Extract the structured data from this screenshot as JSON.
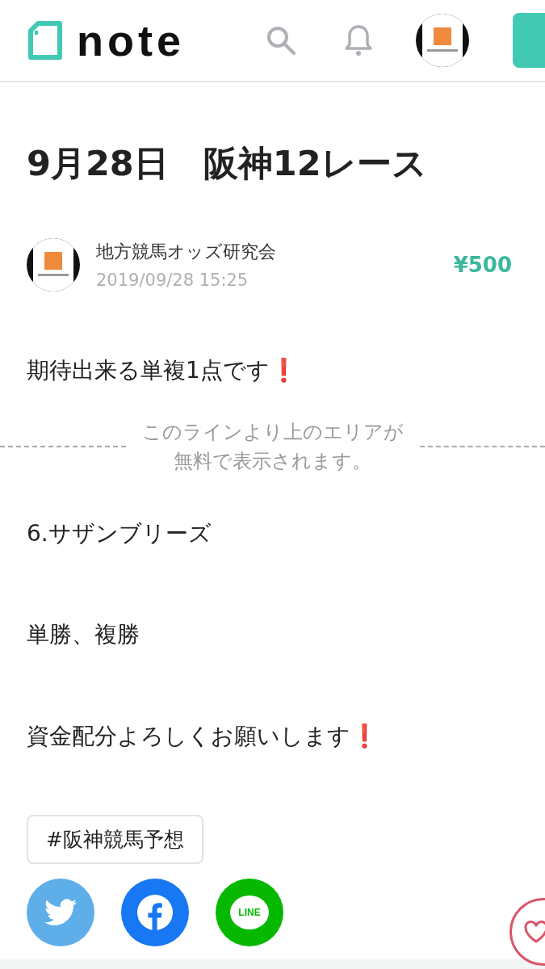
{
  "header": {
    "logo": "note"
  },
  "article": {
    "title": "9月28日　阪神12レース",
    "author": {
      "name": "地方競馬オッズ研究会",
      "date": "2019/09/28 15:25"
    },
    "price": "¥500",
    "free_paragraphs": [
      "期待出来る単複1点です❗"
    ],
    "paywall_notice": [
      "このラインより上のエリアが",
      "無料で表示されます。"
    ],
    "paid_paragraphs": [
      "6.サザンブリーズ",
      "単勝、複勝",
      "資金配分よろしくお願いします❗"
    ],
    "tags": [
      "#阪神競馬予想"
    ],
    "share_buttons": [
      {
        "kind": "twitter"
      },
      {
        "kind": "facebook"
      },
      {
        "kind": "line",
        "label": "LINE"
      }
    ]
  }
}
